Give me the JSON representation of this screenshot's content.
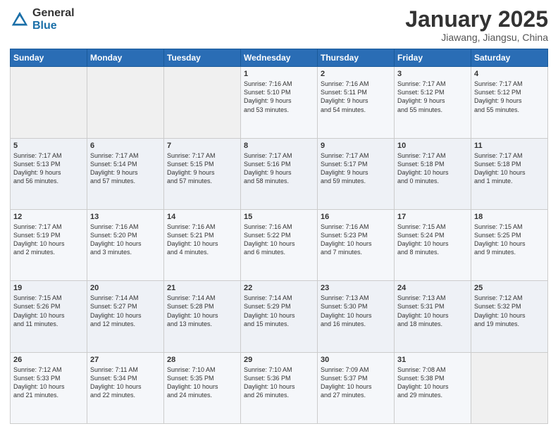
{
  "header": {
    "logo_general": "General",
    "logo_blue": "Blue",
    "title": "January 2025",
    "subtitle": "Jiawang, Jiangsu, China"
  },
  "days_of_week": [
    "Sunday",
    "Monday",
    "Tuesday",
    "Wednesday",
    "Thursday",
    "Friday",
    "Saturday"
  ],
  "weeks": [
    [
      {
        "day": "",
        "info": ""
      },
      {
        "day": "",
        "info": ""
      },
      {
        "day": "",
        "info": ""
      },
      {
        "day": "1",
        "info": "Sunrise: 7:16 AM\nSunset: 5:10 PM\nDaylight: 9 hours\nand 53 minutes."
      },
      {
        "day": "2",
        "info": "Sunrise: 7:16 AM\nSunset: 5:11 PM\nDaylight: 9 hours\nand 54 minutes."
      },
      {
        "day": "3",
        "info": "Sunrise: 7:17 AM\nSunset: 5:12 PM\nDaylight: 9 hours\nand 55 minutes."
      },
      {
        "day": "4",
        "info": "Sunrise: 7:17 AM\nSunset: 5:12 PM\nDaylight: 9 hours\nand 55 minutes."
      }
    ],
    [
      {
        "day": "5",
        "info": "Sunrise: 7:17 AM\nSunset: 5:13 PM\nDaylight: 9 hours\nand 56 minutes."
      },
      {
        "day": "6",
        "info": "Sunrise: 7:17 AM\nSunset: 5:14 PM\nDaylight: 9 hours\nand 57 minutes."
      },
      {
        "day": "7",
        "info": "Sunrise: 7:17 AM\nSunset: 5:15 PM\nDaylight: 9 hours\nand 57 minutes."
      },
      {
        "day": "8",
        "info": "Sunrise: 7:17 AM\nSunset: 5:16 PM\nDaylight: 9 hours\nand 58 minutes."
      },
      {
        "day": "9",
        "info": "Sunrise: 7:17 AM\nSunset: 5:17 PM\nDaylight: 9 hours\nand 59 minutes."
      },
      {
        "day": "10",
        "info": "Sunrise: 7:17 AM\nSunset: 5:18 PM\nDaylight: 10 hours\nand 0 minutes."
      },
      {
        "day": "11",
        "info": "Sunrise: 7:17 AM\nSunset: 5:18 PM\nDaylight: 10 hours\nand 1 minute."
      }
    ],
    [
      {
        "day": "12",
        "info": "Sunrise: 7:17 AM\nSunset: 5:19 PM\nDaylight: 10 hours\nand 2 minutes."
      },
      {
        "day": "13",
        "info": "Sunrise: 7:16 AM\nSunset: 5:20 PM\nDaylight: 10 hours\nand 3 minutes."
      },
      {
        "day": "14",
        "info": "Sunrise: 7:16 AM\nSunset: 5:21 PM\nDaylight: 10 hours\nand 4 minutes."
      },
      {
        "day": "15",
        "info": "Sunrise: 7:16 AM\nSunset: 5:22 PM\nDaylight: 10 hours\nand 6 minutes."
      },
      {
        "day": "16",
        "info": "Sunrise: 7:16 AM\nSunset: 5:23 PM\nDaylight: 10 hours\nand 7 minutes."
      },
      {
        "day": "17",
        "info": "Sunrise: 7:15 AM\nSunset: 5:24 PM\nDaylight: 10 hours\nand 8 minutes."
      },
      {
        "day": "18",
        "info": "Sunrise: 7:15 AM\nSunset: 5:25 PM\nDaylight: 10 hours\nand 9 minutes."
      }
    ],
    [
      {
        "day": "19",
        "info": "Sunrise: 7:15 AM\nSunset: 5:26 PM\nDaylight: 10 hours\nand 11 minutes."
      },
      {
        "day": "20",
        "info": "Sunrise: 7:14 AM\nSunset: 5:27 PM\nDaylight: 10 hours\nand 12 minutes."
      },
      {
        "day": "21",
        "info": "Sunrise: 7:14 AM\nSunset: 5:28 PM\nDaylight: 10 hours\nand 13 minutes."
      },
      {
        "day": "22",
        "info": "Sunrise: 7:14 AM\nSunset: 5:29 PM\nDaylight: 10 hours\nand 15 minutes."
      },
      {
        "day": "23",
        "info": "Sunrise: 7:13 AM\nSunset: 5:30 PM\nDaylight: 10 hours\nand 16 minutes."
      },
      {
        "day": "24",
        "info": "Sunrise: 7:13 AM\nSunset: 5:31 PM\nDaylight: 10 hours\nand 18 minutes."
      },
      {
        "day": "25",
        "info": "Sunrise: 7:12 AM\nSunset: 5:32 PM\nDaylight: 10 hours\nand 19 minutes."
      }
    ],
    [
      {
        "day": "26",
        "info": "Sunrise: 7:12 AM\nSunset: 5:33 PM\nDaylight: 10 hours\nand 21 minutes."
      },
      {
        "day": "27",
        "info": "Sunrise: 7:11 AM\nSunset: 5:34 PM\nDaylight: 10 hours\nand 22 minutes."
      },
      {
        "day": "28",
        "info": "Sunrise: 7:10 AM\nSunset: 5:35 PM\nDaylight: 10 hours\nand 24 minutes."
      },
      {
        "day": "29",
        "info": "Sunrise: 7:10 AM\nSunset: 5:36 PM\nDaylight: 10 hours\nand 26 minutes."
      },
      {
        "day": "30",
        "info": "Sunrise: 7:09 AM\nSunset: 5:37 PM\nDaylight: 10 hours\nand 27 minutes."
      },
      {
        "day": "31",
        "info": "Sunrise: 7:08 AM\nSunset: 5:38 PM\nDaylight: 10 hours\nand 29 minutes."
      },
      {
        "day": "",
        "info": ""
      }
    ]
  ]
}
